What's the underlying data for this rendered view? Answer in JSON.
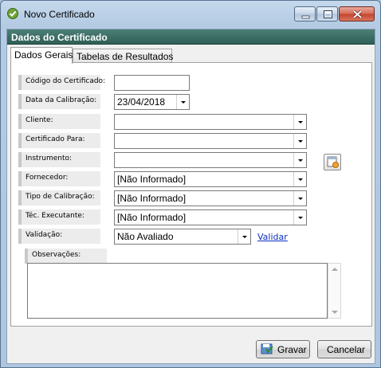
{
  "window": {
    "title": "Novo Certificado",
    "icon": "check-shield-icon",
    "controls": [
      "minimize-icon",
      "maximize-icon",
      "close-icon"
    ]
  },
  "header": {
    "title": "Dados do Certificado"
  },
  "tabs": [
    {
      "label": "Dados Gerais",
      "active": true
    },
    {
      "label": "Tabelas de Resultados",
      "active": false
    }
  ],
  "form": {
    "codigo": {
      "label": "Código do Certificado:",
      "value": ""
    },
    "data": {
      "label": "Data da Calibração:",
      "value": "23/04/2018"
    },
    "cliente": {
      "label": "Cliente:",
      "value": ""
    },
    "certificado_para": {
      "label": "Certificado Para:",
      "value": ""
    },
    "instrumento": {
      "label": "Instrumento:",
      "value": "",
      "side_button_icon": "new-record-icon"
    },
    "fornecedor": {
      "label": "Fornecedor:",
      "value": "[Não Informado]"
    },
    "tipo_calibracao": {
      "label": "Tipo de Calibração:",
      "value": "[Não Informado]"
    },
    "tec_executante": {
      "label": "Téc. Executante:",
      "value": "[Não Informado]"
    },
    "validacao": {
      "label": "Validação:",
      "value": "Não Avaliado",
      "link": "Validar"
    },
    "observacoes": {
      "label": "Observações:",
      "value": ""
    }
  },
  "buttons": {
    "save": {
      "label": "Gravar",
      "icon": "save-icon"
    },
    "cancel": {
      "label": "Cancelar"
    }
  },
  "colors": {
    "header_band": "#2f5f57",
    "link": "#0b2fc7",
    "window_frame": "#b4cbe3"
  }
}
